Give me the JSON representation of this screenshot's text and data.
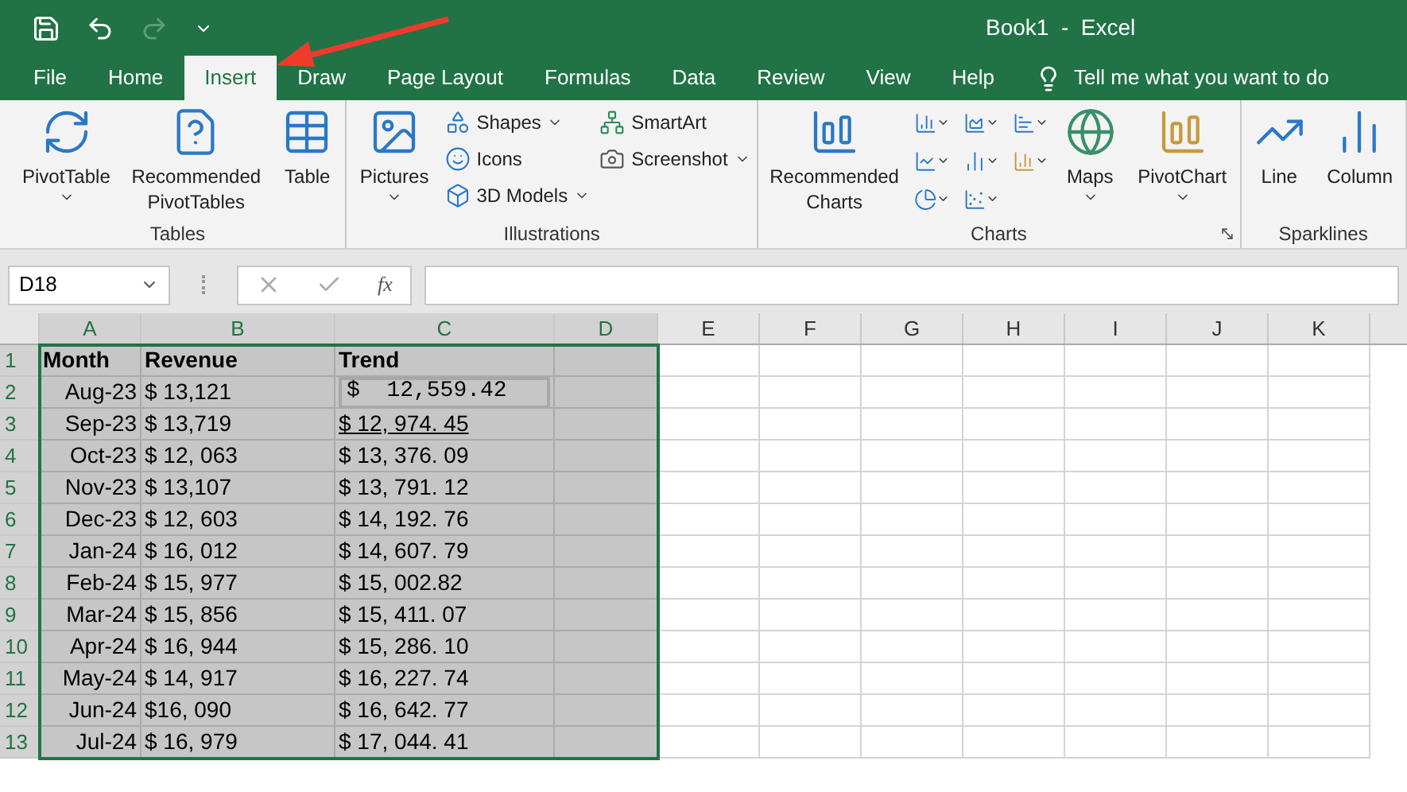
{
  "window": {
    "title": "Book1  -  Excel"
  },
  "quick_access": [
    {
      "kind": "save",
      "disabled": false
    },
    {
      "kind": "undo",
      "disabled": false
    },
    {
      "kind": "redo",
      "disabled": true
    },
    {
      "kind": "customize",
      "disabled": false
    }
  ],
  "tabs": [
    {
      "label": "File",
      "selected": false
    },
    {
      "label": "Home",
      "selected": false
    },
    {
      "label": "Insert",
      "selected": true
    },
    {
      "label": "Draw",
      "selected": false
    },
    {
      "label": "Page Layout",
      "selected": false
    },
    {
      "label": "Formulas",
      "selected": false
    },
    {
      "label": "Data",
      "selected": false
    },
    {
      "label": "Review",
      "selected": false
    },
    {
      "label": "View",
      "selected": false
    },
    {
      "label": "Help",
      "selected": false
    }
  ],
  "tell_me": "Tell me what you want to do",
  "ribbon_groups": [
    {
      "name": "Tables",
      "launcher": false,
      "items": [
        {
          "kind": "large",
          "label": "PivotTable",
          "dropdown": true
        },
        {
          "kind": "large",
          "label": "Recommended PivotTables",
          "dropdown": false
        },
        {
          "kind": "large",
          "label": "Table",
          "dropdown": false
        }
      ]
    },
    {
      "name": "Illustrations",
      "launcher": false,
      "items": [
        {
          "kind": "large",
          "label": "Pictures",
          "dropdown": true
        },
        {
          "kind": "stack",
          "items": [
            {
              "label": "Shapes",
              "dropdown": true
            },
            {
              "label": "Icons",
              "dropdown": false
            },
            {
              "label": "3D Models",
              "dropdown": true
            }
          ]
        },
        {
          "kind": "stack",
          "items": [
            {
              "label": "SmartArt",
              "dropdown": false
            },
            {
              "label": "Screenshot",
              "dropdown": true
            }
          ]
        }
      ]
    },
    {
      "name": "Charts",
      "launcher": true,
      "items": [
        {
          "kind": "large",
          "label": "Recommended Charts",
          "dropdown": false
        },
        {
          "kind": "grid"
        },
        {
          "kind": "large",
          "label": "Maps",
          "dropdown": true
        },
        {
          "kind": "large",
          "label": "PivotChart",
          "dropdown": true
        }
      ]
    },
    {
      "name": "Sparklines",
      "launcher": false,
      "items": [
        {
          "kind": "large",
          "label": "Line",
          "dropdown": false
        },
        {
          "kind": "large",
          "label": "Column",
          "dropdown": false
        }
      ]
    }
  ],
  "name_box": "D18",
  "fx": "fx",
  "columns": [
    {
      "label": "A",
      "selected": true
    },
    {
      "label": "B",
      "selected": true
    },
    {
      "label": "C",
      "selected": true
    },
    {
      "label": "D",
      "selected": true
    },
    {
      "label": "E",
      "selected": false
    },
    {
      "label": "F",
      "selected": false
    },
    {
      "label": "G",
      "selected": false
    },
    {
      "label": "H",
      "selected": false
    },
    {
      "label": "I",
      "selected": false
    },
    {
      "label": "J",
      "selected": false
    },
    {
      "label": "K",
      "selected": false
    }
  ],
  "header_row": {
    "num": "1",
    "selected": true,
    "month": "Month",
    "revenue": "Revenue",
    "trend": "Trend"
  },
  "rows": [
    {
      "num": "2",
      "selected": true,
      "month": "Aug-23",
      "revenue": "$ 13,121",
      "trend": "$  12,559.42",
      "active": true,
      "underlined": false
    },
    {
      "num": "3",
      "selected": true,
      "month": "Sep-23",
      "revenue": "$ 13,719",
      "trend": "$ 12, 974. 45",
      "active": false,
      "underlined": true
    },
    {
      "num": "4",
      "selected": true,
      "month": "Oct-23",
      "revenue": "$ 12, 063",
      "trend": "$ 13, 376. 09",
      "active": false,
      "underlined": false
    },
    {
      "num": "5",
      "selected": true,
      "month": "Nov-23",
      "revenue": "$ 13,107",
      "trend": "$ 13, 791. 12",
      "active": false,
      "underlined": false
    },
    {
      "num": "6",
      "selected": true,
      "month": "Dec-23",
      "revenue": "$ 12, 603",
      "trend": "$ 14, 192. 76",
      "active": false,
      "underlined": false
    },
    {
      "num": "7",
      "selected": true,
      "month": "Jan-24",
      "revenue": "$ 16, 012",
      "trend": "$ 14, 607. 79",
      "active": false,
      "underlined": false
    },
    {
      "num": "8",
      "selected": true,
      "month": "Feb-24",
      "revenue": "$ 15, 977",
      "trend": "$ 15, 002.82",
      "active": false,
      "underlined": false
    },
    {
      "num": "9",
      "selected": true,
      "month": "Mar-24",
      "revenue": "$ 15, 856",
      "trend": "$ 15, 411. 07",
      "active": false,
      "underlined": false
    },
    {
      "num": "10",
      "selected": true,
      "month": "Apr-24",
      "revenue": "$ 16, 944",
      "trend": "$ 15, 286. 10",
      "active": false,
      "underlined": false
    },
    {
      "num": "11",
      "selected": true,
      "month": "May-24",
      "revenue": "$ 14, 917",
      "trend": "$ 16, 227. 74",
      "active": false,
      "underlined": false
    },
    {
      "num": "12",
      "selected": true,
      "month": "Jun-24",
      "revenue": "$16, 090",
      "trend": "$ 16, 642. 77",
      "active": false,
      "underlined": false
    },
    {
      "num": "13",
      "selected": true,
      "month": "Jul-24",
      "revenue": "$ 16, 979",
      "trend": "$ 17, 044. 41",
      "active": false,
      "underlined": false
    }
  ]
}
